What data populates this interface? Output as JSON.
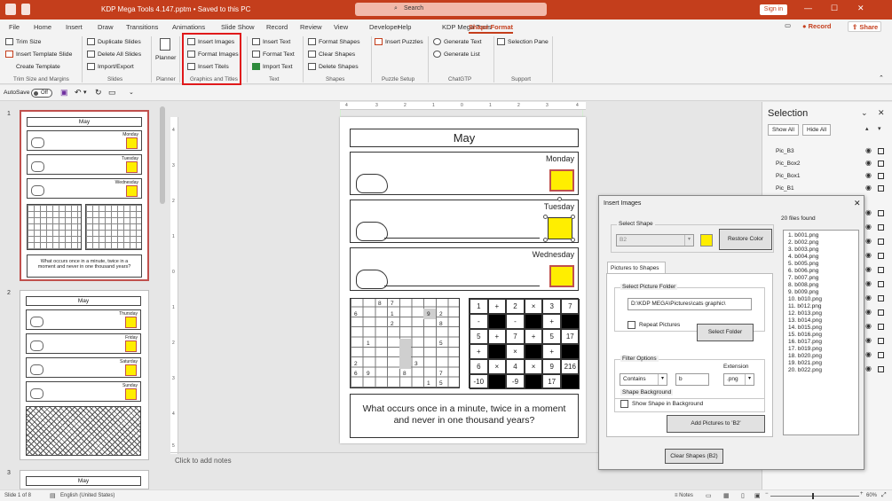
{
  "titlebar": {
    "title": "KDP Mega Tools 4.147.pptm • Saved to this PC",
    "search": "Search",
    "signin": "Sign in",
    "minimize": "—",
    "maximize": "☐",
    "close": "✕"
  },
  "menu": {
    "tabs": [
      "File",
      "Home",
      "Insert",
      "Draw",
      "Transitions",
      "Animations",
      "Slide Show",
      "Record",
      "Review",
      "View",
      "Developer",
      "Help",
      "KDP Mega Tools",
      "Shape Format"
    ],
    "record": "Record",
    "share": "Share"
  },
  "ribbon": {
    "trim": {
      "trim_size": "Trim Size",
      "insert_template_slide": "Insert Template Slide",
      "create_template": "Create Template",
      "group": "Trim Size and Margins"
    },
    "slides": {
      "duplicate": "Duplicate Slides",
      "delete_all": "Delete All Slides",
      "import_export": "Import/Export",
      "group": "Slides"
    },
    "planner": {
      "label": "Planner",
      "group": "Planner"
    },
    "graphics": {
      "insert_images": "Insert Images",
      "format_images": "Format Images",
      "insert_titels": "Insert Titels",
      "group": "Graphics and Titles"
    },
    "text": {
      "insert_text": "Insert Text",
      "format_text": "Format Text",
      "import_text": "Import Text",
      "group": "Text"
    },
    "shapes": {
      "format_shapes": "Format Shapes",
      "clear_shapes": "Clear Shapes",
      "delete_shapes": "Delete Shapes",
      "group": "Shapes"
    },
    "puzzle": {
      "insert_puzzles": "Insert Puzzles",
      "group": "Puzzle Setup"
    },
    "chatgtp": {
      "generate_text": "Generate Text",
      "generate_list": "Generate List",
      "group": "ChatGTP"
    },
    "support": {
      "selection_pane": "Selection Pane",
      "group": "Support"
    }
  },
  "qat": {
    "autosave": "AutoSave",
    "toggle": "Off"
  },
  "thumbnails": {
    "slide1": {
      "num": "1",
      "title": "May",
      "days": [
        "Monday",
        "Tuesday",
        "Wednesday"
      ],
      "riddle": "What occurs once in a minute, twice in a moment and never in one thousand years?"
    },
    "slide2": {
      "num": "2",
      "title": "May",
      "days": [
        "Thursday",
        "Friday",
        "Saturday",
        "Sunday"
      ]
    },
    "slide3": {
      "num": "3",
      "title": "May"
    }
  },
  "rulers": {
    "h": [
      "4",
      "3",
      "2",
      "1",
      "0",
      "1",
      "2",
      "3",
      "4"
    ],
    "v": [
      "4",
      "3",
      "2",
      "1",
      "0",
      "1",
      "2",
      "3",
      "4",
      "5"
    ]
  },
  "slide": {
    "title": "May",
    "days": [
      "Monday",
      "Tuesday",
      "Wednesday"
    ],
    "riddle": "What occurs once in a minute, twice in a moment and never in one thousand years?",
    "sudoku": [
      [
        "8",
        "7",
        ""
      ],
      [
        "6",
        "1",
        "9",
        "2"
      ],
      [
        "2",
        "8"
      ],
      [
        "1",
        "5"
      ],
      [
        "3",
        "2"
      ],
      [
        "6",
        "9",
        "8",
        "7"
      ],
      [
        "1",
        "5"
      ]
    ],
    "math": [
      [
        "1",
        "+",
        "2",
        "×",
        "3",
        "7"
      ],
      [
        "-",
        "",
        "-",
        "",
        "+",
        ""
      ],
      [
        "5",
        "+",
        "7",
        "+",
        "5",
        "17"
      ],
      [
        "+",
        "",
        "×",
        "",
        "+",
        ""
      ],
      [
        "6",
        "×",
        "4",
        "×",
        "9",
        "216"
      ],
      [
        "-10",
        "",
        "-9",
        "",
        "17",
        ""
      ]
    ]
  },
  "notes": {
    "placeholder": "Click to add notes"
  },
  "selection": {
    "title": "Selection",
    "show_all": "Show All",
    "hide_all": "Hide All",
    "items": [
      "Pic_B3",
      "Pic_Box2",
      "Pic_Box1",
      "Pic_B1"
    ]
  },
  "dialog": {
    "title": "Insert Images",
    "select_shape": "Select Shape",
    "shape_value": "B2",
    "restore_color": "Restore Color",
    "tab": "Pictures to Shapes",
    "select_folder_group": "Select Picture Folder",
    "folder_path": "D:\\KDP MEGA\\Pictures\\cats graphic\\",
    "repeat_pictures": "Repeat Pictures",
    "select_folder": "Select Folder",
    "filter_group": "Filter Options",
    "filter_mode": "Contains",
    "filter_text": "b",
    "extension_label": "Extension",
    "extension": ".png",
    "bg_group": "Shape Background",
    "show_shape_bg": "Show Shape in Background",
    "add_pictures": "Add Pictures to 'B2'",
    "clear_shapes": "Clear Shapes (B2)",
    "files_found": "20 files found",
    "files": [
      "1. b001.png",
      "2. b002.png",
      "3. b003.png",
      "4. b004.png",
      "5. b005.png",
      "6. b006.png",
      "7. b007.png",
      "8. b008.png",
      "9. b009.png",
      "10. b010.png",
      "11. b012.png",
      "12. b013.png",
      "13. b014.png",
      "14. b015.png",
      "15. b016.png",
      "16. b017.png",
      "17. b019.png",
      "18. b020.png",
      "19. b021.png",
      "20. b022.png"
    ]
  },
  "status": {
    "slide": "Slide 1 of 8",
    "language": "English (United States)",
    "notes": "Notes",
    "zoom": "60%"
  },
  "colors": {
    "accent": "#c43e1c",
    "highlight": "#e0191b",
    "yellow": "#ffee00"
  }
}
